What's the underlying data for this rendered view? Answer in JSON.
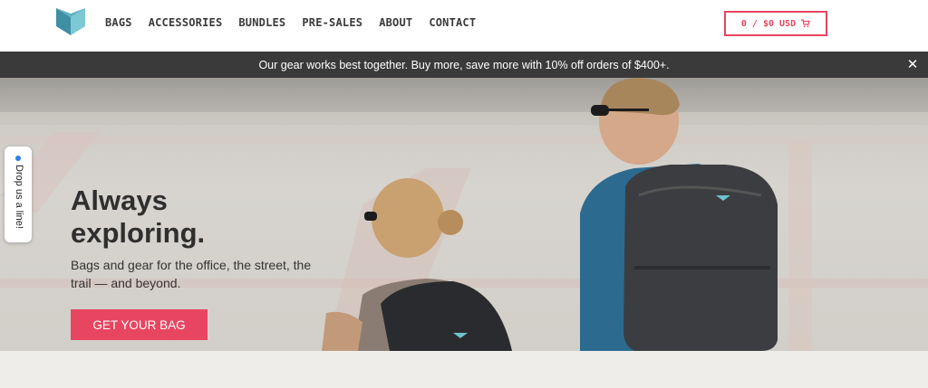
{
  "header": {
    "logo_icon": "brand-logo-icon",
    "nav": [
      {
        "label": "BAGS"
      },
      {
        "label": "ACCESSORIES"
      },
      {
        "label": "BUNDLES"
      },
      {
        "label": "PRE-SALES"
      },
      {
        "label": "ABOUT"
      },
      {
        "label": "CONTACT"
      }
    ],
    "cart": {
      "label": "0 / $0 USD",
      "icon": "cart-icon"
    }
  },
  "announcement": {
    "text": "Our gear works best together. Buy more, save more with 10% off orders of $400+.",
    "close_label": "✕"
  },
  "hero": {
    "title": "Always exploring.",
    "subtitle": "Bags and gear for the office, the street, the trail — and beyond.",
    "cta_label": "GET YOUR BAG"
  },
  "side_tab": {
    "label": "Drop us a line!"
  },
  "colors": {
    "accent": "#e84561",
    "announce_bg": "#3a3a3a",
    "logo_light": "#7cc8d4",
    "logo_dark": "#3f8fa3"
  }
}
